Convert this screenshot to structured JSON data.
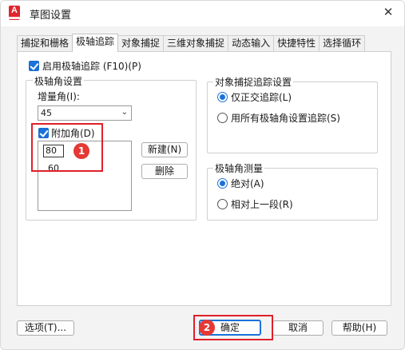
{
  "window": {
    "title": "草图设置",
    "close_glyph": "✕",
    "app_icon": "autocad-app-icon",
    "app_icon_letter": "A"
  },
  "tabs": [
    {
      "label": "捕捉和栅格",
      "active": false
    },
    {
      "label": "极轴追踪",
      "active": true
    },
    {
      "label": "对象捕捉",
      "active": false
    },
    {
      "label": "三维对象捕捉",
      "active": false
    },
    {
      "label": "动态输入",
      "active": false
    },
    {
      "label": "快捷特性",
      "active": false
    },
    {
      "label": "选择循环",
      "active": false
    }
  ],
  "polar": {
    "enable_label": "启用极轴追踪 (F10)(P)",
    "enable_checked": true,
    "settings_group": "极轴角设置",
    "increment_label": "增量角(I):",
    "increment_value": "45",
    "additional_label": "附加角(D)",
    "additional_checked": true,
    "additional_items": [
      "80",
      "60"
    ],
    "new_button": "新建(N)",
    "delete_button": "删除"
  },
  "snap_tracking": {
    "group": "对象捕捉追踪设置",
    "option_ortho": "仅正交追踪(L)",
    "option_all": "用所有极轴角设置追踪(S)",
    "selected": "ortho"
  },
  "measurement": {
    "group": "极轴角测量",
    "option_absolute": "绝对(A)",
    "option_relative": "相对上一段(R)",
    "selected": "absolute"
  },
  "footer": {
    "options_button": "选项(T)...",
    "ok_button": "确定",
    "cancel_button": "取消",
    "help_button": "帮助(H)"
  },
  "annotations": {
    "marker1": "1",
    "marker2": "2",
    "color": "#e0202a"
  },
  "colors": {
    "accent": "#1a73d9",
    "app_icon": "#e0252b"
  }
}
